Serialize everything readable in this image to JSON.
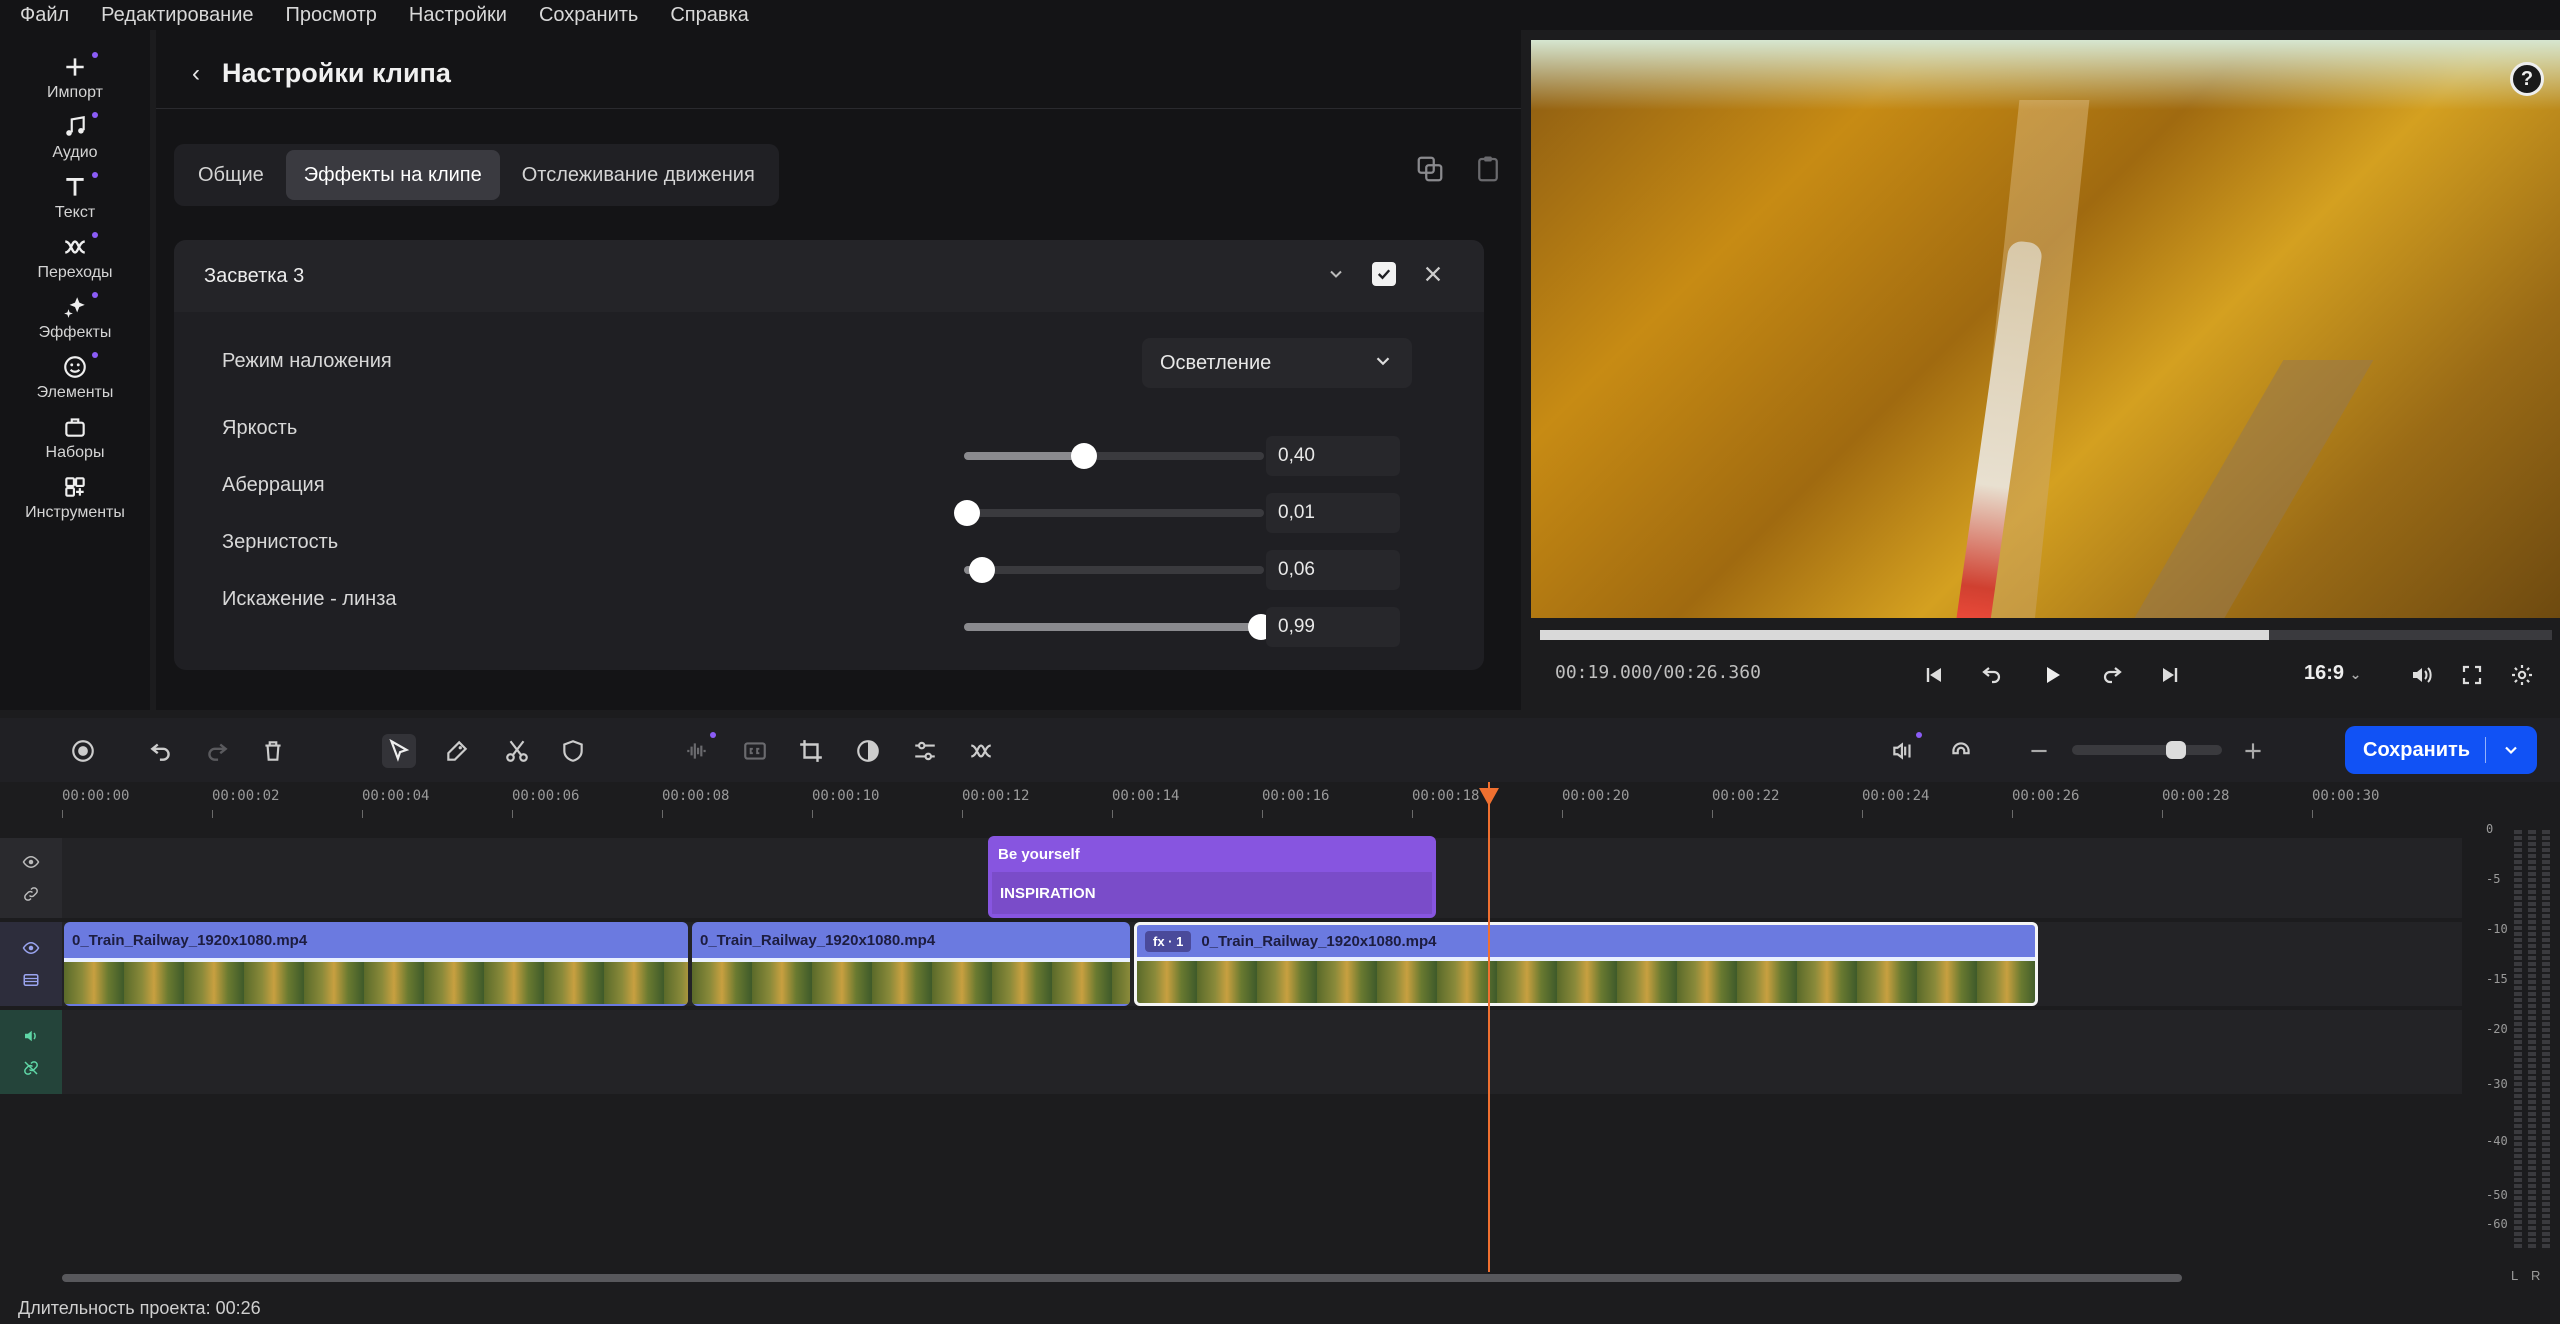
{
  "menu": [
    "Файл",
    "Редактирование",
    "Просмотр",
    "Настройки",
    "Сохранить",
    "Справка"
  ],
  "sidebar": {
    "items": [
      {
        "label": "Импорт",
        "icon": "plus-icon"
      },
      {
        "label": "Аудио",
        "icon": "music-note-icon"
      },
      {
        "label": "Текст",
        "icon": "text-icon"
      },
      {
        "label": "Переходы",
        "icon": "transition-icon"
      },
      {
        "label": "Эффекты",
        "icon": "sparkle-icon"
      },
      {
        "label": "Элементы",
        "icon": "smiley-icon"
      },
      {
        "label": "Наборы",
        "icon": "bag-icon"
      },
      {
        "label": "Инструменты",
        "icon": "grid-plus-icon"
      }
    ]
  },
  "panel": {
    "title": "Настройки клипа",
    "tabs": [
      "Общие",
      "Эффекты на клипе",
      "Отслеживание движения"
    ],
    "active_tab": "Эффекты на клипе",
    "effect": {
      "name": "Засветка 3",
      "enabled": true,
      "blend_label": "Режим наложения",
      "blend_value": "Осветление",
      "params": [
        {
          "label": "Яркость",
          "value": "0,40",
          "fraction": 0.4
        },
        {
          "label": "Аберрация",
          "value": "0,01",
          "fraction": 0.01
        },
        {
          "label": "Зернистость",
          "value": "0,06",
          "fraction": 0.06
        },
        {
          "label": "Искажение - линза",
          "value": "0,99",
          "fraction": 0.99
        }
      ]
    }
  },
  "preview": {
    "timecode": "00:19.000/00:26.360",
    "progress": 0.72,
    "ratio": "16:9"
  },
  "toolbar": {
    "save_label": "Сохранить",
    "zoom_fraction": 0.72
  },
  "timeline": {
    "ticks": [
      "00:00:00",
      "00:00:02",
      "00:00:04",
      "00:00:06",
      "00:00:08",
      "00:00:10",
      "00:00:12",
      "00:00:14",
      "00:00:16",
      "00:00:18",
      "00:00:20",
      "00:00:22",
      "00:00:24",
      "00:00:26",
      "00:00:28",
      "00:00:30"
    ],
    "title_clip": {
      "line1": "Be yourself",
      "line2": "INSPIRATION"
    },
    "clips": [
      {
        "name": "0_Train_Railway_1920x1080.mp4",
        "fx": ""
      },
      {
        "name": "0_Train_Railway_1920x1080.mp4",
        "fx": ""
      },
      {
        "name": "0_Train_Railway_1920x1080.mp4",
        "fx": "fx · 1"
      }
    ],
    "meter_labels": [
      "0",
      "-5",
      "-10",
      "-15",
      "-20",
      "-30",
      "-40",
      "-50",
      "-60"
    ],
    "channels": [
      "L",
      "R"
    ]
  },
  "status": "Длительность проекта: 00:26",
  "colors": {
    "accent": "#1152f5",
    "purple": "#8755e0",
    "clip": "#6b7ae0",
    "playhead": "#f07030"
  }
}
